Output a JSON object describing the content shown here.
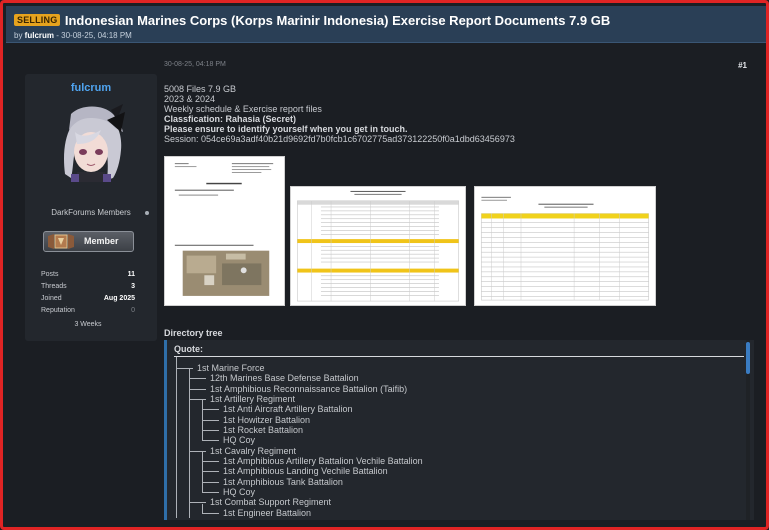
{
  "thread": {
    "badge": "SELLING",
    "title": "Indonesian Marines Corps (Korps Marinir Indonesia) Exercise Report Documents 7.9 GB",
    "by_prefix": "by ",
    "author": "fulcrum",
    "date_text": " - 30-08-25, 04:18 PM"
  },
  "post": {
    "date": "30-08-25, 04:18 PM",
    "number": "#1"
  },
  "user": {
    "name": "fulcrum",
    "group": "DarkForums Members",
    "rank": "Member",
    "stats": [
      {
        "label": "Posts",
        "value": "11"
      },
      {
        "label": "Threads",
        "value": "3"
      },
      {
        "label": "Joined",
        "value": "Aug 2025"
      },
      {
        "label": "Reputation",
        "value": "0"
      }
    ],
    "extra": "3 Weeks"
  },
  "content": {
    "line1": "5008 Files 7.9 GB",
    "line2": "2023 & 2024",
    "line3": "Weekly schedule & Exercise report files",
    "line4": "Classfication: Rahasia (Secret)",
    "line5": "Please ensure to identify yourself when you get in touch.",
    "line6": "Session: 054ce69a3adf40b21d9692fd7b0fcb1c6702775ad373122250f0a1dbd63456973"
  },
  "directory": {
    "title": "Directory tree",
    "quote_label": "Quote:",
    "tree": [
      {
        "depth": 0,
        "text": "1st Marine Force"
      },
      {
        "depth": 1,
        "text": "12th Marines Base Defense Battalion"
      },
      {
        "depth": 1,
        "text": "1st Amphibious Reconnaissance Battalion (Taifib)"
      },
      {
        "depth": 1,
        "text": "1st Artillery Regiment"
      },
      {
        "depth": 2,
        "text": "1st Anti Aircraft Artillery Battalion"
      },
      {
        "depth": 2,
        "text": "1st Howitzer Battalion"
      },
      {
        "depth": 2,
        "text": "1st Rocket Battalion"
      },
      {
        "depth": 2,
        "text": "HQ Coy"
      },
      {
        "depth": 1,
        "text": "1st Cavalry Regiment"
      },
      {
        "depth": 2,
        "text": "1st Amphibious Artillery Battalion Vechile Battalion"
      },
      {
        "depth": 2,
        "text": "1st Amphibious Landing Vechile Battalion"
      },
      {
        "depth": 2,
        "text": "1st Amphibious Tank Battalion"
      },
      {
        "depth": 2,
        "text": "HQ Coy"
      },
      {
        "depth": 1,
        "text": "1st Combat Support Regiment"
      },
      {
        "depth": 2,
        "text": "1st Engineer Battalion"
      }
    ]
  }
}
